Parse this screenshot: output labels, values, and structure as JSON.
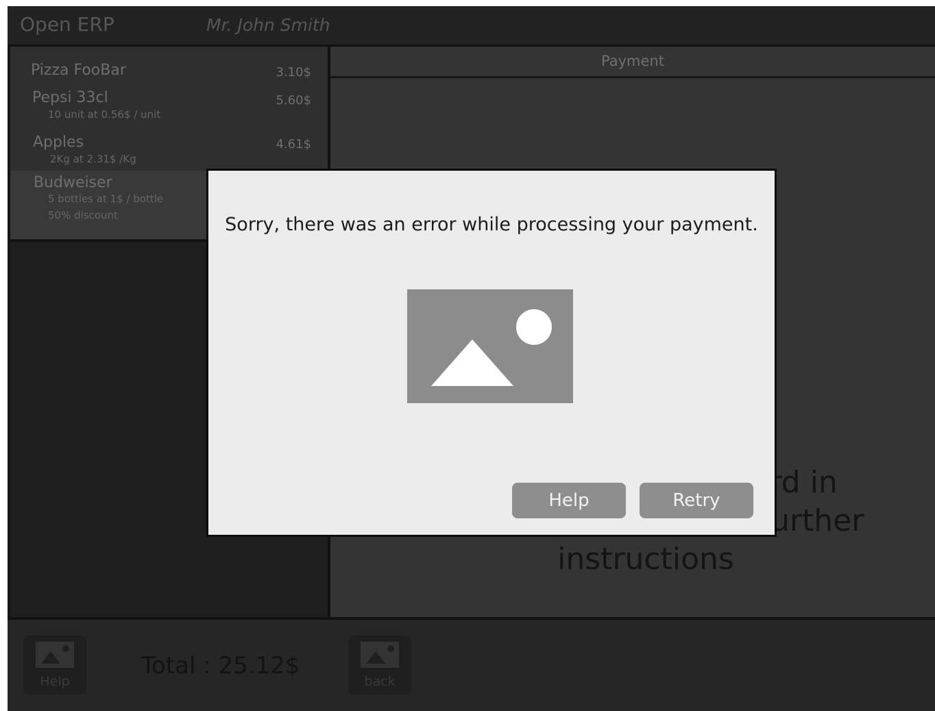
{
  "header": {
    "app_title": "Open ERP",
    "user_name": "Mr. John Smith"
  },
  "order": {
    "items": [
      {
        "name": "Pizza FooBar",
        "price": "3.10$",
        "details": []
      },
      {
        "name": "Pepsi 33cl",
        "price": "5.60$",
        "details": [
          "10 unit at 0.56$ / unit"
        ]
      },
      {
        "name": "Apples",
        "price": "4.61$",
        "details": [
          "2Kg at 2.31$ /Kg"
        ]
      },
      {
        "name": "Budweiser",
        "price": "",
        "details": [
          "5 bottles at 1$ / bottle",
          "50% discount"
        ],
        "selected": true
      }
    ]
  },
  "payment": {
    "header": "Payment",
    "instruction_lines": [
      "Please insert your card in",
      "the reader and follow further",
      "instructions"
    ]
  },
  "footer": {
    "help_label": "Help",
    "back_label": "back",
    "total": "Total : 25.12$"
  },
  "modal": {
    "message": "Sorry, there was an error while processing your payment.",
    "image_icon": "image-placeholder-icon",
    "help_label": "Help",
    "retry_label": "Retry"
  }
}
